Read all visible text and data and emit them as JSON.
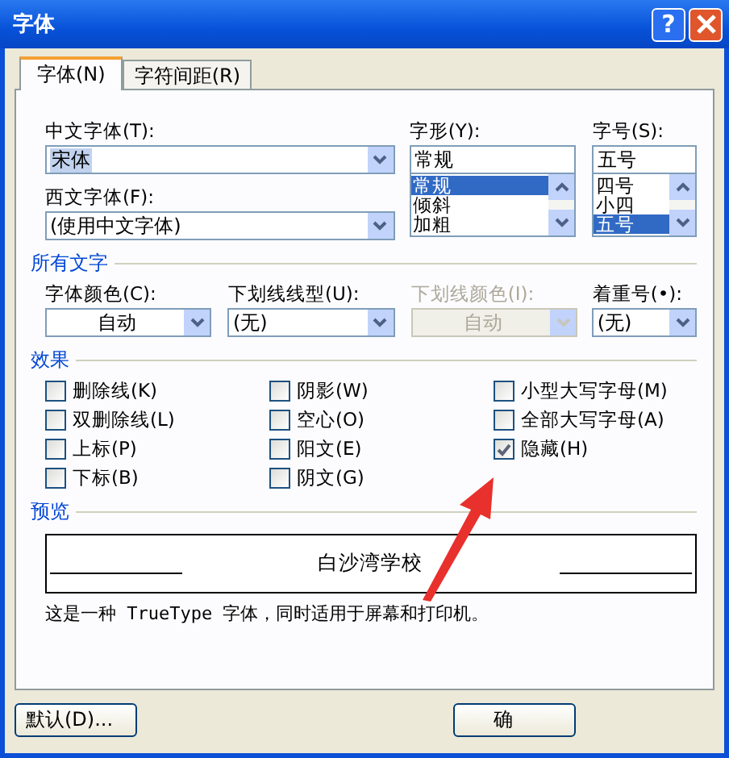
{
  "window": {
    "title": "字体",
    "help_label": "?"
  },
  "tabs": [
    {
      "label": "字体(N)",
      "selected": true
    },
    {
      "label": "字符间距(R)",
      "selected": false
    }
  ],
  "font_fields": {
    "chinese": {
      "label": "中文字体(T):",
      "value": "宋体"
    },
    "western": {
      "label": "西文字体(F):",
      "value": "(使用中文字体)"
    }
  },
  "style_list": {
    "label": "字形(Y):",
    "value": "常规",
    "items": [
      {
        "label": "常规",
        "selected": true
      },
      {
        "label": "倾斜",
        "selected": false
      },
      {
        "label": "加粗",
        "selected": false
      }
    ]
  },
  "size_list": {
    "label": "字号(S):",
    "value": "五号",
    "items": [
      {
        "label": "四号",
        "selected": false
      },
      {
        "label": "小四",
        "selected": false
      },
      {
        "label": "五号",
        "selected": true
      }
    ]
  },
  "all_text": {
    "heading": "所有文字",
    "dropdowns": [
      {
        "kind": "color",
        "label": "字体颜色(C):",
        "value": "自动",
        "disabled": false
      },
      {
        "kind": "list",
        "label": "下划线线型(U):",
        "value": "(无)",
        "disabled": false
      },
      {
        "kind": "color",
        "label": "下划线颜色(I):",
        "value": "自动",
        "disabled": true
      },
      {
        "kind": "list",
        "label": "着重号(•):",
        "value": "(无)",
        "disabled": false
      }
    ]
  },
  "effects": {
    "heading": "效果",
    "columns": [
      [
        {
          "label": "删除线(K)",
          "checked": false
        },
        {
          "label": "双删除线(L)",
          "checked": false
        },
        {
          "label": "上标(P)",
          "checked": false
        },
        {
          "label": "下标(B)",
          "checked": false
        }
      ],
      [
        {
          "label": "阴影(W)",
          "checked": false
        },
        {
          "label": "空心(O)",
          "checked": false
        },
        {
          "label": "阳文(E)",
          "checked": false
        },
        {
          "label": "阴文(G)",
          "checked": false
        }
      ],
      [
        {
          "label": "小型大写字母(M)",
          "checked": false
        },
        {
          "label": "全部大写字母(A)",
          "checked": false
        },
        {
          "label": "隐藏(H)",
          "checked": true
        }
      ]
    ]
  },
  "preview": {
    "heading": "预览",
    "sample": "白沙湾学校",
    "note": "这是一种 TrueType 字体，同时适用于屏幕和打印机。"
  },
  "buttons": [
    "默认(D)...",
    "确"
  ]
}
